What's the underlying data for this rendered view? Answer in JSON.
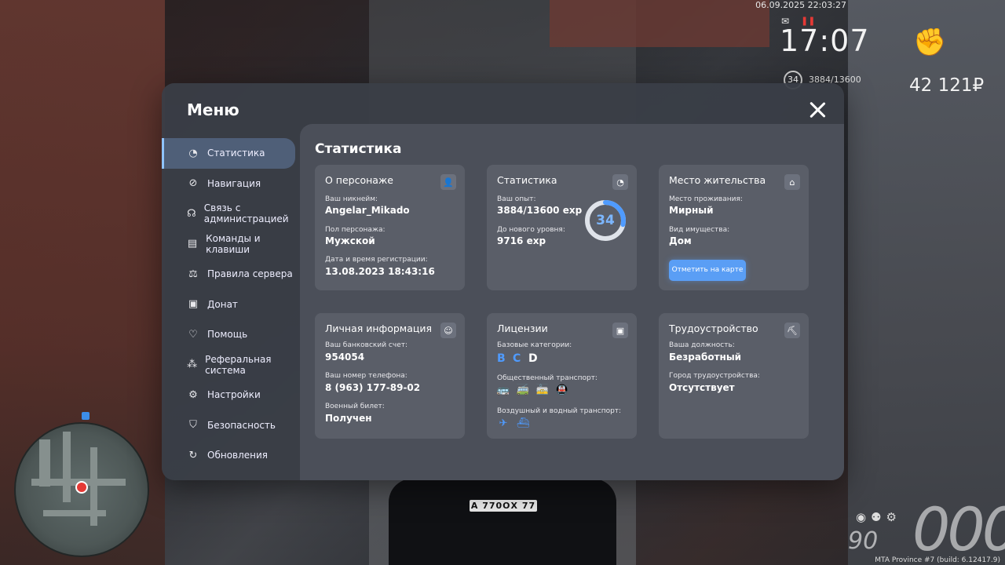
{
  "hud": {
    "datetime": "06.09.2025 22:03:27",
    "time": "17:07",
    "level": "34",
    "exp": "3884/13600",
    "money": "42 121₽",
    "speed": "000",
    "fuel": "90",
    "build": "MTA Province #7 (build: 6.12417.9)",
    "plate": "А 770ОХ 77"
  },
  "menu": {
    "title": "Меню",
    "sidebar": [
      {
        "label": "Статистика",
        "icon": "pie-chart-icon",
        "glyph": "◔",
        "active": true
      },
      {
        "label": "Навигация",
        "icon": "compass-icon",
        "glyph": "⊘"
      },
      {
        "label": "Связь с администрацией",
        "icon": "headset-icon",
        "glyph": "☊"
      },
      {
        "label": "Команды и клавиши",
        "icon": "document-icon",
        "glyph": "▤"
      },
      {
        "label": "Правила сервера",
        "icon": "scales-icon",
        "glyph": "⚖"
      },
      {
        "label": "Донат",
        "icon": "wallet-icon",
        "glyph": "▣"
      },
      {
        "label": "Помощь",
        "icon": "heart-hands-icon",
        "glyph": "♡"
      },
      {
        "label": "Реферальная система",
        "icon": "referral-icon",
        "glyph": "⁂"
      },
      {
        "label": "Настройки",
        "icon": "gear-icon",
        "glyph": "⚙"
      },
      {
        "label": "Безопасность",
        "icon": "shield-icon",
        "glyph": "⛉"
      },
      {
        "label": "Обновления",
        "icon": "update-icon",
        "glyph": "↻"
      }
    ]
  },
  "content": {
    "title": "Статистика",
    "character": {
      "title": "О персонаже",
      "nick_label": "Ваш никнейм:",
      "nick": "Angelar_Mikado",
      "gender_label": "Пол персонажа:",
      "gender": "Мужской",
      "reg_label": "Дата и время регистрации:",
      "reg": "13.08.2023 18:43:16"
    },
    "stats": {
      "title": "Статистика",
      "exp_label": "Ваш опыт:",
      "exp": "3884/13600 exp",
      "next_label": "До нового уровня:",
      "next": "9716 exp",
      "level": "34",
      "level_progress": 0.2856,
      "accent": "#7cb6ff"
    },
    "residence": {
      "title": "Место жительства",
      "place_label": "Место проживания:",
      "place": "Мирный",
      "property_label": "Вид имущества:",
      "property": "Дом",
      "button": "Отметить на карте"
    },
    "personal": {
      "title": "Личная информация",
      "bank_label": "Ваш банковский счет:",
      "bank": "954054",
      "phone_label": "Ваш номер телефона:",
      "phone": "8 (963) 177-89-02",
      "military_label": "Военный билет:",
      "military": "Получен"
    },
    "licenses": {
      "title": "Лицензии",
      "basic_label": "Базовые категории:",
      "categories": [
        {
          "letter": "B",
          "owned": true
        },
        {
          "letter": "C",
          "owned": true
        },
        {
          "letter": "D",
          "owned": false
        }
      ],
      "public_label": "Общественный транспорт:",
      "public_icons": [
        {
          "name": "bus-icon",
          "glyph": "🚌",
          "owned": true
        },
        {
          "name": "trolleybus-icon",
          "glyph": "🚎",
          "owned": true
        },
        {
          "name": "tram-icon",
          "glyph": "🚋",
          "owned": true
        },
        {
          "name": "metro-icon",
          "glyph": "🚇",
          "owned": false
        }
      ],
      "air_label": "Воздушный и водный транспорт:",
      "air_icons": [
        {
          "name": "plane-icon",
          "glyph": "✈",
          "owned": true
        },
        {
          "name": "ship-icon",
          "glyph": "⛴",
          "owned": true
        }
      ]
    },
    "employment": {
      "title": "Трудоустройство",
      "position_label": "Ваша должность:",
      "position": "Безработный",
      "city_label": "Город трудоустройства:",
      "city": "Отсутствует"
    }
  }
}
